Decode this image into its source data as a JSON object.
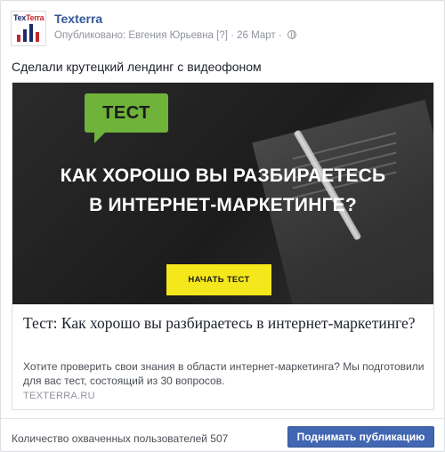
{
  "header": {
    "avatar_word_1": "Tex",
    "avatar_word_2": "Terra",
    "page_name": "Texterra",
    "meta_prefix": "Опубликовано: ",
    "author": "Евгения Юрьевна",
    "help_mark": "[?]",
    "date": "· 26 Март ·"
  },
  "post": {
    "text": "Сделали крутецкий лендинг с видеофоном"
  },
  "link_preview": {
    "hero": {
      "badge": "ТЕСТ",
      "title_line_1": "КАК ХОРОШО ВЫ РАЗБИРАЕТЕСЬ",
      "title_line_2": "В ИНТЕРНЕТ-МАРКЕТИНГЕ?",
      "cta": "НАЧАТЬ ТЕСТ"
    },
    "title": "Тест: Как хорошо вы разбираетесь в интернет-маркетинге?",
    "description": "Хотите проверить свои знания в области интернет-маркетинга? Мы подготовили для вас тест, состоящий из 30 вопросов.",
    "domain": "TEXTERRA.RU"
  },
  "footer": {
    "reach_text": "Количество охваченных пользователей 507",
    "boost_label": "Поднимать публикацию"
  },
  "colors": {
    "link_blue": "#365899",
    "button_blue": "#4267b2",
    "badge_green": "#6fb33b",
    "cta_yellow": "#f4e71b"
  },
  "icons": [
    "globe-icon",
    "logo-bars-icon",
    "pen-image"
  ]
}
